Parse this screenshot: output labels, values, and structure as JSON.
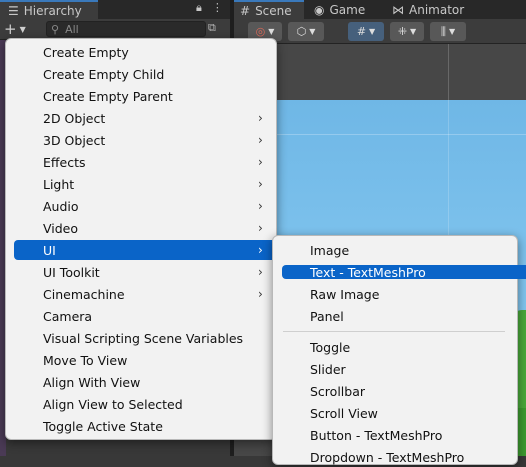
{
  "hierarchy": {
    "tab_label": "Hierarchy",
    "tab_icon": "list-icon",
    "add_button_label": "+",
    "search_placeholder": "All"
  },
  "scene_tabs": [
    {
      "label": "Scene",
      "icon": "grid-icon",
      "active": true
    },
    {
      "label": "Game",
      "icon": "gamepad-icon",
      "active": false
    },
    {
      "label": "Animator",
      "icon": "animator-icon",
      "active": false
    }
  ],
  "create_menu": {
    "items": [
      {
        "label": "Create Empty",
        "submenu": false
      },
      {
        "label": "Create Empty Child",
        "submenu": false
      },
      {
        "label": "Create Empty Parent",
        "submenu": false
      },
      {
        "label": "2D Object",
        "submenu": true
      },
      {
        "label": "3D Object",
        "submenu": true
      },
      {
        "label": "Effects",
        "submenu": true
      },
      {
        "label": "Light",
        "submenu": true
      },
      {
        "label": "Audio",
        "submenu": true
      },
      {
        "label": "Video",
        "submenu": true
      },
      {
        "label": "UI",
        "submenu": true,
        "highlighted": true
      },
      {
        "label": "UI Toolkit",
        "submenu": true
      },
      {
        "label": "Cinemachine",
        "submenu": true
      },
      {
        "label": "Camera",
        "submenu": false
      },
      {
        "label": "Visual Scripting Scene Variables",
        "submenu": false
      },
      {
        "label": "Move To View",
        "submenu": false
      },
      {
        "label": "Align With View",
        "submenu": false
      },
      {
        "label": "Align View to Selected",
        "submenu": false
      },
      {
        "label": "Toggle Active State",
        "submenu": false
      }
    ]
  },
  "ui_submenu": {
    "items": [
      {
        "label": "Image"
      },
      {
        "label": "Text - TextMeshPro",
        "highlighted": true
      },
      {
        "label": "Raw Image"
      },
      {
        "label": "Panel"
      },
      {
        "label": "Toggle"
      },
      {
        "label": "Slider"
      },
      {
        "label": "Scrollbar"
      },
      {
        "label": "Scroll View"
      },
      {
        "label": "Button - TextMeshPro"
      },
      {
        "label": "Dropdown - TextMeshPro"
      }
    ]
  }
}
